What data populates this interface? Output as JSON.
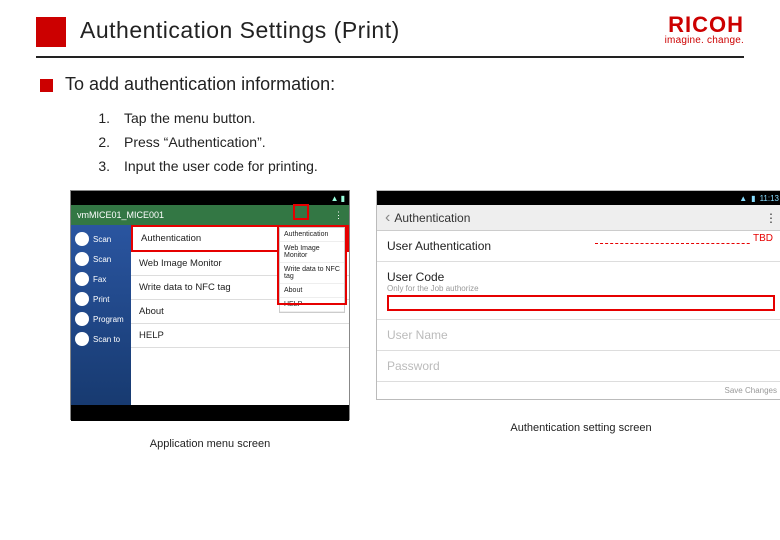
{
  "header": {
    "title": "Authentication Settings (Print)",
    "logo_name": "RICOH",
    "logo_tagline": "imagine. change."
  },
  "bullet": "To add authentication information:",
  "steps": [
    {
      "n": "1.",
      "t": "Tap the menu button."
    },
    {
      "n": "2.",
      "t": "Press “Authentication”."
    },
    {
      "n": "3.",
      "t": "Input the user code for printing."
    }
  ],
  "left_mock": {
    "appbar": "vmMICE01_MICE001",
    "sidebar": [
      "Scan",
      "Scan",
      "Fax",
      "Print",
      "Program",
      "Scan to"
    ],
    "menu": {
      "auth": "Authentication",
      "wim": "Web Image Monitor",
      "nfc": "Write data to NFC tag",
      "about": "About",
      "help": "HELP"
    },
    "dropdown": [
      "Authentication",
      "Web Image Monitor",
      "Write data to NFC tag",
      "About",
      "HELP"
    ],
    "caption": "Application menu screen"
  },
  "right_mock": {
    "status_time": "11:13",
    "appbar": "Authentication",
    "rows": {
      "ua": "User Authentication",
      "uc": "User Code",
      "uc_sub": "Only for the Job authorize",
      "un": "User Name",
      "pw": "Password"
    },
    "tbd": "TBD",
    "save": "Save Changes",
    "caption": "Authentication setting screen"
  }
}
